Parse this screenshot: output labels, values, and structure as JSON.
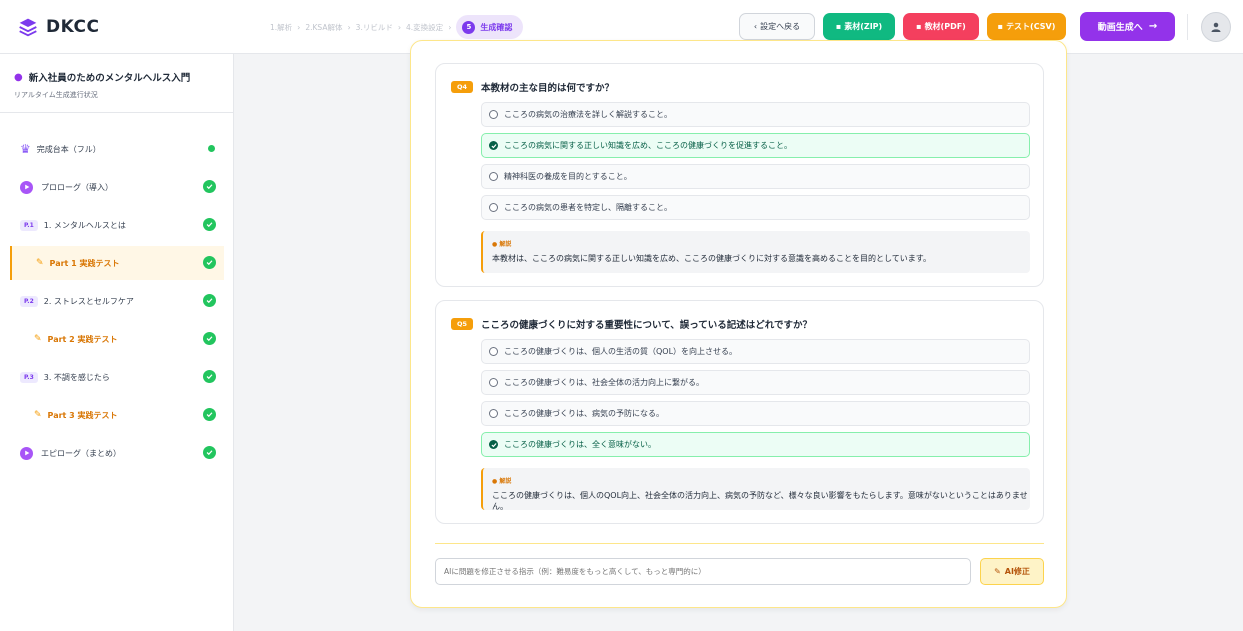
{
  "app": {
    "name": "DKCC"
  },
  "steps": [
    {
      "label": "1.解析"
    },
    {
      "label": "2.KSA解体"
    },
    {
      "label": "3.リビルド"
    },
    {
      "label": "4.変換設定"
    },
    {
      "label": "生成確認",
      "number": "5",
      "active": true
    }
  ],
  "header_buttons": {
    "back": "設定へ戻る",
    "zip": "素材(ZIP)",
    "pdf": "教材(PDF)",
    "csv": "テスト(CSV)",
    "video": "動画生成へ"
  },
  "colors": {
    "accent": "#9333ea",
    "success": "#22c55e",
    "warning": "#f59e0b",
    "danger": "#f43f5e",
    "emerald": "#10b981"
  },
  "sidebar": {
    "title": "新入社員のためのメンタルヘルス入門",
    "subtitle": "リアルタイム生成進行状況",
    "items": [
      {
        "label": "完成台本（フル）",
        "type": "full",
        "status": "dot"
      },
      {
        "label": "プロローグ（導入）",
        "type": "play",
        "status": "done"
      },
      {
        "label": "1. メンタルヘルスとは",
        "badge": "P.1",
        "type": "part",
        "status": "done"
      },
      {
        "label": "Part 1 実践テスト",
        "type": "test",
        "active": true,
        "status": "done"
      },
      {
        "label": "2. ストレスとセルフケア",
        "badge": "P.2",
        "type": "part",
        "status": "done"
      },
      {
        "label": "Part 2 実践テスト",
        "type": "test",
        "status": "done"
      },
      {
        "label": "3. 不調を感じたら",
        "badge": "P.3",
        "type": "part",
        "status": "done"
      },
      {
        "label": "Part 3 実践テスト",
        "type": "test",
        "status": "done"
      },
      {
        "label": "エピローグ（まとめ）",
        "type": "play",
        "status": "done"
      }
    ]
  },
  "questions": [
    {
      "number": "Q4",
      "text": "本教材の主な目的は何ですか？",
      "options": [
        {
          "text": "こころの病気の治療法を詳しく解説すること。",
          "correct": false
        },
        {
          "text": "こころの病気に関する正しい知識を広め、こころの健康づくりを促進すること。",
          "correct": true
        },
        {
          "text": "精神科医の養成を目的とすること。",
          "correct": false
        },
        {
          "text": "こころの病気の患者を特定し、隔離すること。",
          "correct": false
        }
      ],
      "explanation_label": "解説",
      "explanation": "本教材は、こころの病気に関する正しい知識を広め、こころの健康づくりに対する意識を高めることを目的としています。"
    },
    {
      "number": "Q5",
      "text": "こころの健康づくりに対する重要性について、誤っている記述はどれですか？",
      "options": [
        {
          "text": "こころの健康づくりは、個人の生活の質（QOL）を向上させる。",
          "correct": false
        },
        {
          "text": "こころの健康づくりは、社会全体の活力向上に繋がる。",
          "correct": false
        },
        {
          "text": "こころの健康づくりは、病気の予防になる。",
          "correct": false
        },
        {
          "text": "こころの健康づくりは、全く意味がない。",
          "correct": true
        }
      ],
      "explanation_label": "解説",
      "explanation": "こころの健康づくりは、個人のQOL向上、社会全体の活力向上、病気の予防など、様々な良い影響をもたらします。意味がないということはありません。"
    }
  ],
  "ai_fix": {
    "placeholder": "AIに問題を修正させる指示（例：難易度をもっと高くして、もっと専門的に）",
    "button": "AI修正"
  }
}
